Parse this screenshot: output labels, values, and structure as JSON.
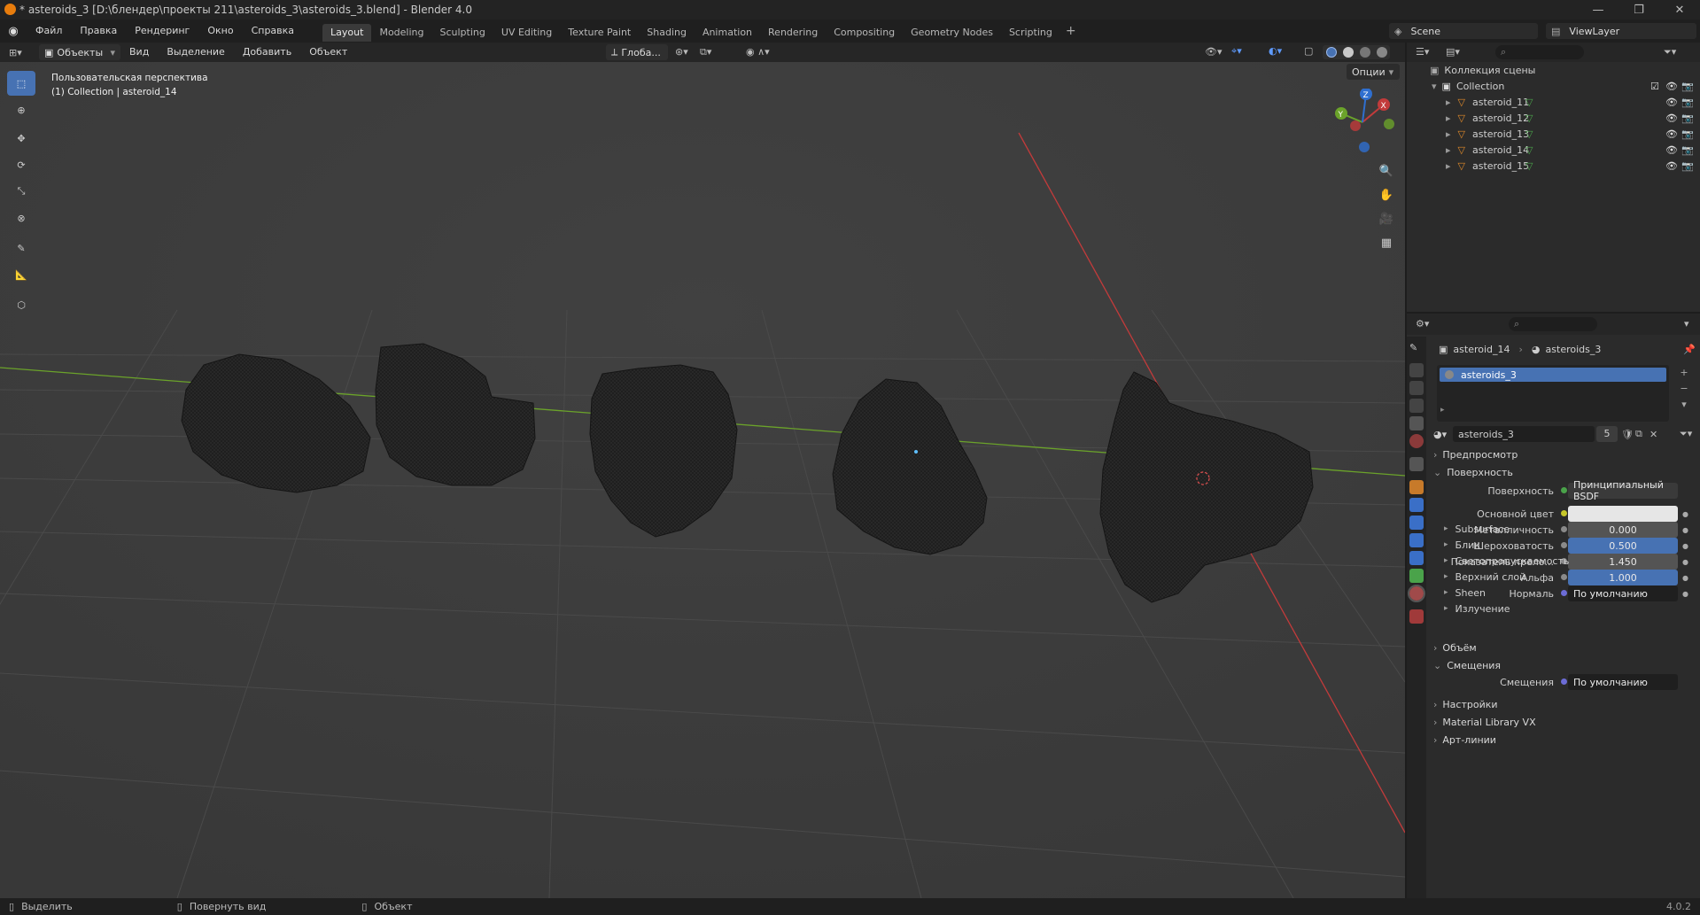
{
  "title": "* asteroids_3 [D:\\блендер\\проекты 211\\asteroids_3\\asteroids_3.blend] - Blender 4.0",
  "menu": [
    "Файл",
    "Правка",
    "Рендеринг",
    "Окно",
    "Справка"
  ],
  "workspaces": [
    "Layout",
    "Modeling",
    "Sculpting",
    "UV Editing",
    "Texture Paint",
    "Shading",
    "Animation",
    "Rendering",
    "Compositing",
    "Geometry Nodes",
    "Scripting"
  ],
  "active_workspace": "Layout",
  "scene": "Scene",
  "view_layer": "ViewLayer",
  "viewport_header": {
    "mode": "Объекты",
    "menus": [
      "Вид",
      "Выделение",
      "Добавить",
      "Объект"
    ],
    "orientation": "Глоба...",
    "options": "Опции"
  },
  "viewport": {
    "view_name": "Пользовательская перспектива",
    "view_context": "(1) Collection | asteroid_14"
  },
  "outliner": {
    "root": "Коллекция сцены",
    "collection": "Collection",
    "items": [
      "asteroid_11",
      "asteroid_12",
      "asteroid_13",
      "asteroid_14",
      "asteroid_15"
    ]
  },
  "properties": {
    "breadcrumb_object": "asteroid_14",
    "breadcrumb_material": "asteroids_3",
    "slot_name": "asteroids_3",
    "material_name": "asteroids_3",
    "users": "5",
    "preview": "Предпросмотр",
    "surface_panel": "Поверхность",
    "surface_label": "Поверхность",
    "surface_value": "Принципиальный BSDF",
    "fields": [
      {
        "label": "Основной цвет",
        "value": ""
      },
      {
        "label": "Металличность",
        "value": "0.000"
      },
      {
        "label": "Шероховатость",
        "value": "0.500"
      },
      {
        "label": "Показатель прело...",
        "value": "1.450"
      },
      {
        "label": "Альфа",
        "value": "1.000"
      },
      {
        "label": "Нормаль",
        "value": "По умолчанию"
      }
    ],
    "subpanels": [
      "Subsurface",
      "Блик",
      "Светопропускаемость",
      "Верхний слой",
      "Sheen",
      "Излучение"
    ],
    "volume": "Объём",
    "displacement_panel": "Смещения",
    "displacement_label": "Смещения",
    "displacement_value": "По умолчанию",
    "settings": "Настройки",
    "material_library": "Material Library VX",
    "lineart": "Арт-линии"
  },
  "status": {
    "select": "Выделить",
    "rotate": "Повернуть вид",
    "object": "Объект",
    "version": "4.0.2"
  },
  "colors": {
    "accent": "#4772b3",
    "x_axis": "#c23b3b",
    "y_axis": "#6ba32a",
    "z_axis": "#2f6fcf"
  }
}
